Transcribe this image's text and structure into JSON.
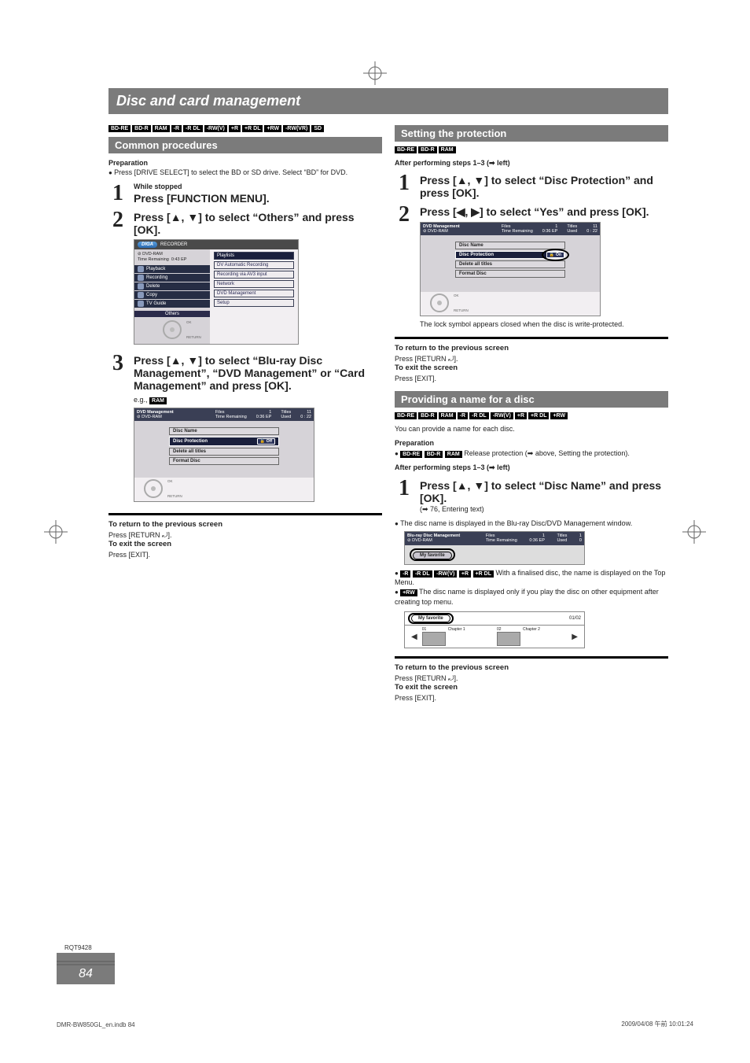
{
  "title": "Disc and card management",
  "formats_all": [
    "BD-RE",
    "BD-R",
    "RAM",
    "-R",
    "-R DL",
    "-RW(V)",
    "+R",
    "+R DL",
    "+RW",
    "-RW(VR)",
    "SD"
  ],
  "common": {
    "heading": "Common procedures",
    "prep_title": "Preparation",
    "prep_text": "Press [DRIVE SELECT] to select the BD or SD drive. Select “BD” for DVD.",
    "step1_sub": "While stopped",
    "step1_title": "Press [FUNCTION MENU].",
    "step2_title": "Press [▲, ▼] to select “Others” and press [OK].",
    "step3_title": "Press [▲, ▼] to select “Blu-ray Disc Management”, “DVD Management” or “Card Management” and press [OK].",
    "eg": "e.g., ",
    "eg_fmt": "RAM"
  },
  "fn_screen": {
    "brand": "DIGA",
    "model": "RECORDER",
    "disc_line1": "DVD-RAM",
    "disc_line2_k": "Time Remaining",
    "disc_line2_v": "0:43 EP",
    "left_items": [
      "Playback",
      "Recording",
      "Delete",
      "Copy",
      "TV Guide",
      "Others"
    ],
    "right_items": [
      "Playlists",
      "DV Automatic Recording",
      "Recording via AV3 input",
      "Network",
      "DVD Management",
      "Setup"
    ],
    "nav_ok": "OK",
    "nav_ret": "RETURN"
  },
  "dvd_mgmt_screen": {
    "hdr_title": "DVD Management",
    "hdr_sub": "DVD-RAM",
    "files_lbl": "Files",
    "files_v": "1",
    "tr_lbl": "Time Remaining",
    "tr_v": "0:36 EP",
    "titles_lbl": "Titles",
    "titles_v": "11",
    "used_lbl": "Used",
    "used_v": "0 : 22",
    "rows": [
      "Disc Name",
      "Disc Protection",
      "Delete all titles",
      "Format Disc"
    ],
    "prot_off": "Off",
    "prot_on": "On",
    "nav_ok": "OK",
    "nav_ret": "RETURN"
  },
  "return_block": {
    "l1": "To return to the previous screen",
    "l2a": "Press [RETURN ",
    "l2b": "].",
    "l3": "To exit the screen",
    "l4": "Press [EXIT]."
  },
  "protection": {
    "heading": "Setting the protection",
    "fmts": [
      "BD-RE",
      "BD-R",
      "RAM"
    ],
    "after": "After performing steps 1–3 (➡ left)",
    "s1": "Press [▲, ▼] to select “Disc Protection” and press [OK].",
    "s2": "Press [◀, ▶] to select “Yes” and press [OK].",
    "note": "The lock symbol appears closed when the disc is write-protected."
  },
  "naming": {
    "heading": "Providing a name for a disc",
    "fmts": [
      "BD-RE",
      "BD-R",
      "RAM",
      "-R",
      "-R DL",
      "-RW(V)",
      "+R",
      "+R DL",
      "+RW"
    ],
    "can": "You can provide a name for each disc.",
    "prep_title": "Preparation",
    "prep_fmts": [
      "BD-RE",
      "BD-R",
      "RAM"
    ],
    "prep_text": " Release protection (➡ above, Setting the protection).",
    "after": "After performing steps 1–3 (➡ left)",
    "s1": "Press [▲, ▼] to select “Disc Name” and press [OK].",
    "s1_ref": "(➡ 76, Entering text)",
    "b1": "The disc name is displayed in the Blu-ray Disc/DVD Management window.",
    "b2_fmts": [
      "-R",
      "-R DL",
      "-RW(V)",
      "+R",
      "+R DL"
    ],
    "b2": " With a finalised disc, the name is displayed on the Top Menu.",
    "b3_fmt": "+RW",
    "b3": " The disc name is displayed only if you play the disc on other equipment after creating top menu."
  },
  "name_screen": {
    "hdr_title": "Blu-ray Disc Management",
    "hdr_sub": "DVD-RAM",
    "files_lbl": "Files",
    "files_v": "1",
    "tr_lbl": "Time Remaining",
    "tr_v": "0:36 EP",
    "titles_lbl": "Titles",
    "titles_v": "1",
    "used_lbl": "Used",
    "used_v": "0",
    "fav": "My favorite"
  },
  "topmenu_screen": {
    "title": "My favorite",
    "pg": "01/02",
    "ch1_n": "01",
    "ch1": "Chapter 1",
    "ch2_n": "02",
    "ch2": "Chapter 2"
  },
  "footer": {
    "rqt": "RQT9428",
    "page": "84",
    "left": "DMR-BW850GL_en.indb   84",
    "right": "2009/04/08   午前 10:01:24"
  }
}
